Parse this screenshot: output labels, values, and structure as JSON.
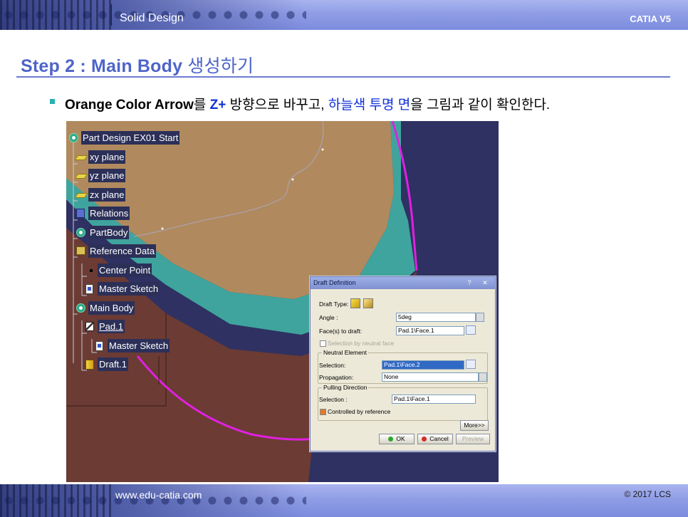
{
  "header": {
    "title": "Solid Design",
    "product": "CATIA V5"
  },
  "footer": {
    "website": "www.edu-catia.com",
    "copyright": "© 2017 LCS"
  },
  "slide": {
    "title_en": "Step 2 : Main Body",
    "title_kr": "생성하기",
    "bullet": {
      "part1": "Orange Color Arrow",
      "part2": "를 ",
      "part3": "Z+",
      "part4": " 방향으로 바꾸고, ",
      "part5": "하늘색 투명 면",
      "part6": "을 그림과 같이 확인한다."
    }
  },
  "tree": {
    "root": "Part Design EX01 Start",
    "xy": "xy plane",
    "yz": "yz plane",
    "zx": "zx plane",
    "relations": "Relations",
    "partbody": "PartBody",
    "refdata": "Reference Data",
    "centerpoint": "Center Point",
    "mastersketch1": "Master Sketch",
    "mainbody": "Main Body",
    "pad": "Pad.1",
    "mastersketch2": "Master Sketch",
    "draft": "Draft.1"
  },
  "dialog": {
    "title": "Draft Definition",
    "help": "?",
    "close": "✕",
    "draft_type_label": "Draft Type:",
    "angle_label": "Angle :",
    "angle_value": "5deg",
    "faces_label": "Face(s) to draft:",
    "faces_value": "Pad.1\\Face.1",
    "neutral_face_checkbox": "Selection by neutral face",
    "neutral_group": "Neutral Element",
    "selection_label": "Selection:",
    "selection_value": "Pad.1\\Face.2",
    "propagation_label": "Propagation:",
    "propagation_value": "None",
    "pulling_group": "Pulling Direction",
    "pulling_selection_label": "Selection :",
    "pulling_selection_value": "Pad.1\\Face.1",
    "controlled_label": "Controlled by reference",
    "more_button": "More>>",
    "ok_button": "OK",
    "cancel_button": "Cancel",
    "preview_button": "Preview"
  },
  "colors": {
    "accent": "#4e64c9",
    "band": "#8f9de6",
    "viewport_bg": "#2e3162",
    "part_top": "#b08a5e",
    "part_side": "#6b3b34",
    "draft_face": "#42b9a8",
    "curve": "#e020e0"
  }
}
